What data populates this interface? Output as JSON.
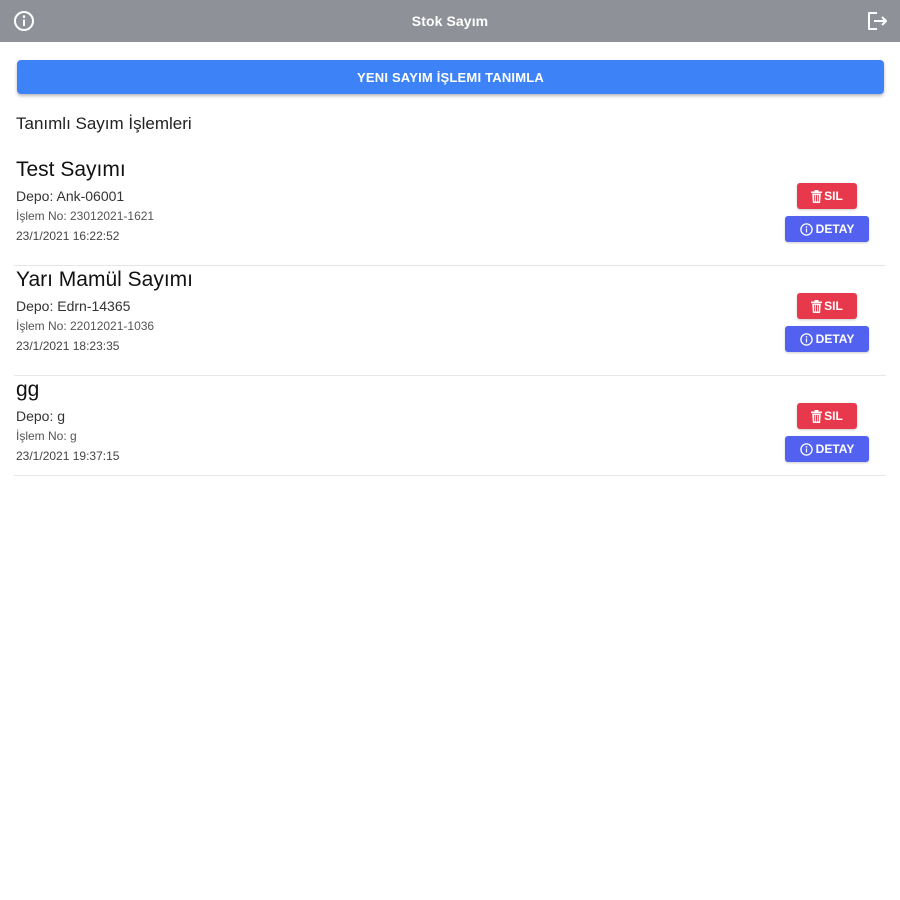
{
  "header": {
    "title": "Stok Sayım",
    "info_icon": "info-circle-icon",
    "logout_icon": "logout-icon",
    "background_color": "#8e9197"
  },
  "new_count_button": {
    "label": "YENI SAYIM İŞLEMI TANIMLA",
    "color": "#3d82f7"
  },
  "section_title": "Tanımlı Sayım İşlemleri",
  "items": [
    {
      "name": "Test Sayımı",
      "depo": "Depo: Ank-06001",
      "islem_no": "İşlem No: 23012021-1621",
      "date": "23/1/2021 16:22:52",
      "delete_label": "SIL",
      "detail_label": "DETAY"
    },
    {
      "name": "Yarı Mamül Sayımı",
      "depo": "Depo: Edrn-14365",
      "islem_no": "İşlem No: 22012021-1036",
      "date": "23/1/2021 18:23:35",
      "delete_label": "SIL",
      "detail_label": "DETAY"
    },
    {
      "name": "gg",
      "depo": "Depo: g",
      "islem_no": "İşlem No: g",
      "date": "23/1/2021 19:37:15",
      "delete_label": "SIL",
      "detail_label": "DETAY"
    }
  ],
  "colors": {
    "delete_button": "#e8394c",
    "detail_button": "#5261f0"
  }
}
